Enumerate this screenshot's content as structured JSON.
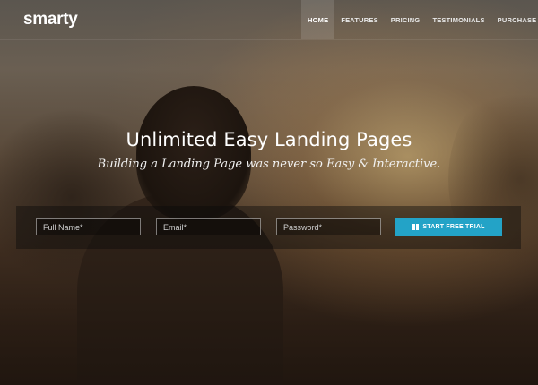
{
  "brand": {
    "logo_text": "smarty"
  },
  "nav": {
    "items": [
      {
        "label": "HOME",
        "active": true
      },
      {
        "label": "FEATURES",
        "active": false
      },
      {
        "label": "PRICING",
        "active": false
      },
      {
        "label": "TESTIMONIALS",
        "active": false
      },
      {
        "label": "PURCHASE",
        "active": false
      }
    ]
  },
  "hero": {
    "title": "Unlimited Easy Landing Pages",
    "subtitle": "Building a Landing Page was never so Easy & Interactive."
  },
  "signup": {
    "name_placeholder": "Full Name*",
    "email_placeholder": "Email*",
    "password_placeholder": "Password*",
    "button_label": "START FREE TRIAL",
    "button_icon": "windows-icon"
  },
  "colors": {
    "accent": "#23a3c7"
  }
}
